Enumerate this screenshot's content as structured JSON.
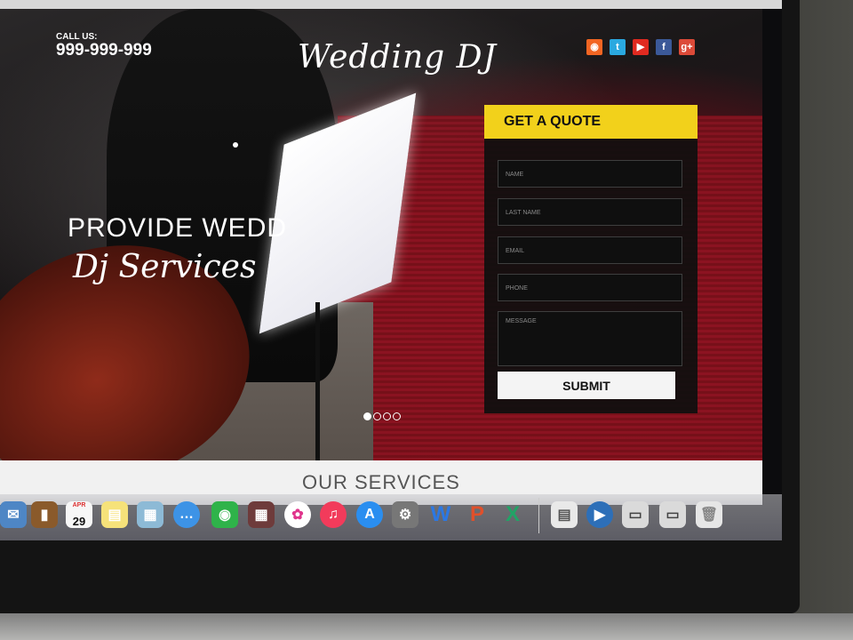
{
  "header": {
    "call_label": "CALL US:",
    "phone": "999-999-999",
    "logo": "Wedding DJ"
  },
  "social": [
    {
      "name": "rss-icon",
      "glyph": "◉",
      "color": "#f26522"
    },
    {
      "name": "twitter-icon",
      "glyph": "t",
      "color": "#2aa9e0"
    },
    {
      "name": "youtube-icon",
      "glyph": "▶",
      "color": "#e02a20"
    },
    {
      "name": "facebook-icon",
      "glyph": "f",
      "color": "#3b5998"
    },
    {
      "name": "googleplus-icon",
      "glyph": "g+",
      "color": "#dc4a38"
    }
  ],
  "hero": {
    "headline": "PROVIDE WEDD",
    "subhead": "Dj Services"
  },
  "quote_form": {
    "title": "GET A QUOTE",
    "fields": {
      "name": "NAME",
      "last_name": "LAST NAME",
      "email": "EMAIL",
      "phone": "PHONE",
      "message": "MESSAGE"
    },
    "submit": "SUBMIT"
  },
  "services": {
    "title": "OUR SERVICES"
  },
  "dock": {
    "calendar_month": "APR",
    "calendar_day": "29",
    "word_letter": "W",
    "powerpoint_letter": "P",
    "excel_letter": "X"
  }
}
